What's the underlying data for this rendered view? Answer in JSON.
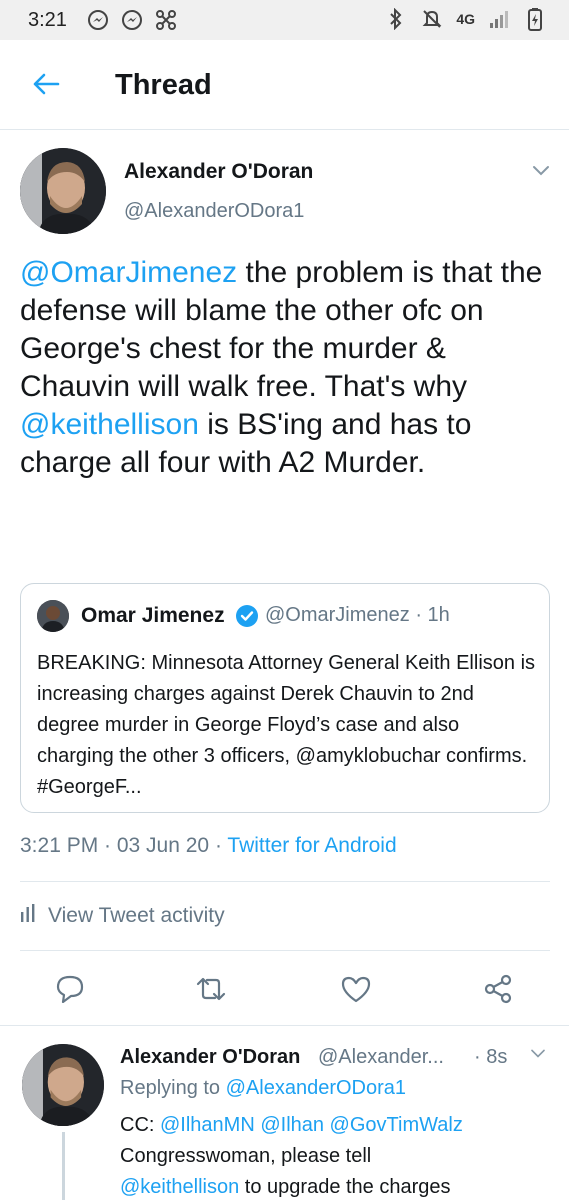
{
  "status_bar": {
    "time": "3:21",
    "network": "4G",
    "left_icons": [
      "messenger-icon",
      "messenger-icon",
      "drone-icon"
    ],
    "right_icons": [
      "bluetooth-icon",
      "mute-icon",
      "signal-icon",
      "battery-icon"
    ]
  },
  "header": {
    "title": "Thread",
    "back_icon": "arrow-left-icon"
  },
  "main_tweet": {
    "author_name": "Alexander O'Doran",
    "author_handle": "@AlexanderODora1",
    "text_parts": {
      "mention1": "@OmarJimenez",
      "part1": " the problem is that the defense will blame the other ofc on George's chest for the murder & Chauvin will walk free. That's why ",
      "mention2": "@keithellison",
      "part2": " is BS'ing and has to charge all four with A2 Murder."
    },
    "quote": {
      "name": "Omar Jimenez",
      "handle_time": "@OmarJimenez · 1h",
      "text": "BREAKING: Minnesota Attorney General Keith Ellison is increasing charges against Derek Chauvin to 2nd degree murder in George Floyd’s case and also charging the other 3 officers, @amyklobuchar confirms. #GeorgeF..."
    },
    "timestamp": "3:21 PM · 03 Jun 20 · ",
    "source": "Twitter for Android",
    "activity_label": "View Tweet activity"
  },
  "actions": [
    "reply-icon",
    "retweet-icon",
    "like-icon",
    "share-icon"
  ],
  "reply": {
    "author_name": "Alexander O'Doran",
    "author_handle": "@Alexander...",
    "time": "· 8s",
    "replying_prefix": "Replying to ",
    "replying_to": "@AlexanderODora1",
    "cc_prefix": "CC: ",
    "cc_mentions": "@IlhanMN @Ilhan @GovTimWalz",
    "line2": "Congresswoman, please tell",
    "line3_mention": "@keithellison",
    "line3_rest": " to upgrade the charges"
  },
  "colors": {
    "accent": "#1da1f2",
    "secondary_text": "#657786",
    "border": "#e1e8ed"
  }
}
